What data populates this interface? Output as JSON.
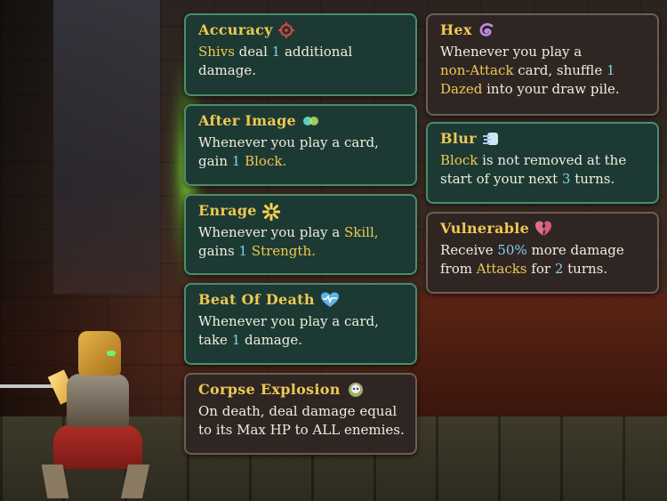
{
  "colors": {
    "keyword": "#efc851",
    "number": "#7fd2e8",
    "body_text": "#f2ecdf",
    "buff_bg": "#1c3a33",
    "debuff_bg": "#2f2624"
  },
  "tooltips_left": [
    {
      "title": "Accuracy",
      "icon": "crosshair-icon",
      "kind": "buff",
      "lines": [
        [
          {
            "t": "Shivs",
            "k": "kw"
          },
          {
            "t": " deal "
          },
          {
            "t": "1",
            "k": "num"
          },
          {
            "t": " additional"
          }
        ],
        [
          {
            "t": "damage."
          }
        ]
      ]
    },
    {
      "title": "After Image",
      "icon": "afterimage-icon",
      "kind": "buff",
      "lines": [
        [
          {
            "t": "Whenever you play a card,"
          }
        ],
        [
          {
            "t": "gain "
          },
          {
            "t": "1",
            "k": "num"
          },
          {
            "t": " "
          },
          {
            "t": "Block.",
            "k": "kw"
          }
        ]
      ]
    },
    {
      "title": "Enrage",
      "icon": "enrage-icon",
      "kind": "buff",
      "lines": [
        [
          {
            "t": "Whenever you play a "
          },
          {
            "t": "Skill,",
            "k": "kw"
          }
        ],
        [
          {
            "t": "gains "
          },
          {
            "t": "1",
            "k": "num"
          },
          {
            "t": " "
          },
          {
            "t": "Strength.",
            "k": "kw"
          }
        ]
      ]
    },
    {
      "title": "Beat Of Death",
      "icon": "heartbeat-icon",
      "kind": "buff",
      "lines": [
        [
          {
            "t": "Whenever you play a card,"
          }
        ],
        [
          {
            "t": "take "
          },
          {
            "t": "1",
            "k": "num"
          },
          {
            "t": " damage."
          }
        ]
      ]
    },
    {
      "title": "Corpse Explosion",
      "icon": "skull-burst-icon",
      "kind": "debuff",
      "lines": [
        [
          {
            "t": "On death, deal damage equal"
          }
        ],
        [
          {
            "t": "to its Max HP to ALL enemies."
          }
        ]
      ]
    }
  ],
  "tooltips_right": [
    {
      "title": "Hex",
      "icon": "hex-swirl-icon",
      "kind": "debuff",
      "lines": [
        [
          {
            "t": "Whenever you play a"
          }
        ],
        [
          {
            "t": "non-Attack",
            "k": "kw"
          },
          {
            "t": " card, shuffle "
          },
          {
            "t": "1",
            "k": "num"
          }
        ],
        [
          {
            "t": "Dazed",
            "k": "kw"
          },
          {
            "t": " into your draw pile."
          }
        ]
      ]
    },
    {
      "title": "Blur",
      "icon": "blur-icon",
      "kind": "buff",
      "lines": [
        [
          {
            "t": "Block",
            "k": "kw"
          },
          {
            "t": " is not removed at the"
          }
        ],
        [
          {
            "t": "start of your next "
          },
          {
            "t": "3",
            "k": "num"
          },
          {
            "t": " turns."
          }
        ]
      ]
    },
    {
      "title": "Vulnerable",
      "icon": "broken-heart-icon",
      "kind": "debuff",
      "lines": [
        [
          {
            "t": "Receive "
          },
          {
            "t": "50%",
            "k": "num"
          },
          {
            "t": " more damage"
          }
        ],
        [
          {
            "t": "from "
          },
          {
            "t": "Attacks",
            "k": "kw"
          },
          {
            "t": " for "
          },
          {
            "t": "2",
            "k": "num"
          },
          {
            "t": " turns."
          }
        ]
      ]
    }
  ]
}
